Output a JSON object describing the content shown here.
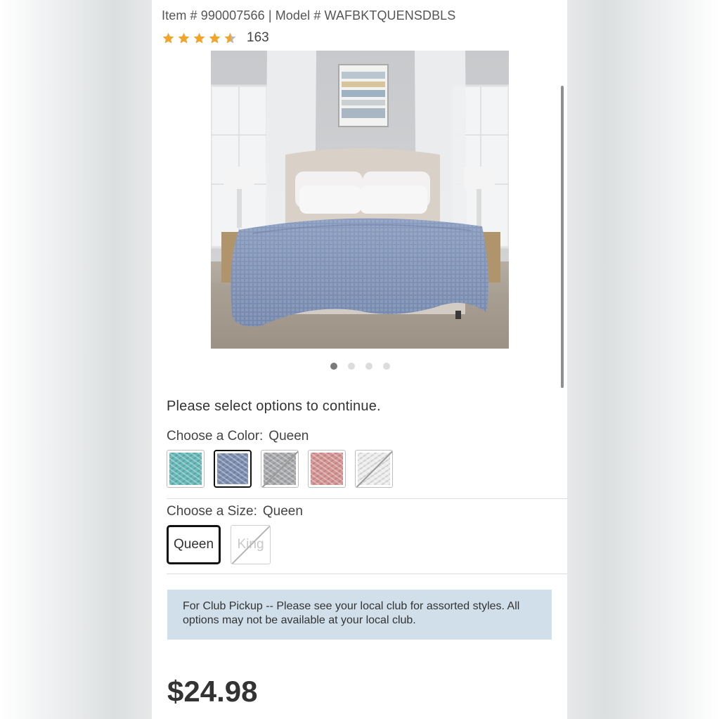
{
  "product": {
    "item_line": "Item # 990007566 | Model # WAFBKTQUENSDBLS",
    "rating": 4.5,
    "review_count": "163",
    "image_icon": "bedroom-photo-blue-waffle-blanket"
  },
  "carousel": {
    "total": 4,
    "active": 1
  },
  "options": {
    "prompt": "Please select options to continue.",
    "color": {
      "label": "Choose a Color:",
      "value": "Queen",
      "swatches": [
        {
          "name": "teal",
          "color": "#67b9ba",
          "selected": false,
          "available": true
        },
        {
          "name": "blue",
          "color": "#7d8fb1",
          "selected": true,
          "available": true
        },
        {
          "name": "gray",
          "color": "#a9aaad",
          "selected": false,
          "available": true
        },
        {
          "name": "pink",
          "color": "#d69595",
          "selected": false,
          "available": true
        },
        {
          "name": "white",
          "color": "#ededed",
          "selected": false,
          "available": false
        }
      ]
    },
    "size": {
      "label": "Choose a Size:",
      "value": "Queen",
      "buttons": [
        {
          "label": "Queen",
          "selected": true,
          "available": true
        },
        {
          "label": "King",
          "selected": false,
          "available": false
        }
      ]
    }
  },
  "notice": "For Club Pickup -- Please see your local club for assorted styles. All options may not be available at your local club.",
  "price": "$24.98",
  "colors": {
    "star": "#f0a52a",
    "notice_bg": "#d0dfe9"
  }
}
